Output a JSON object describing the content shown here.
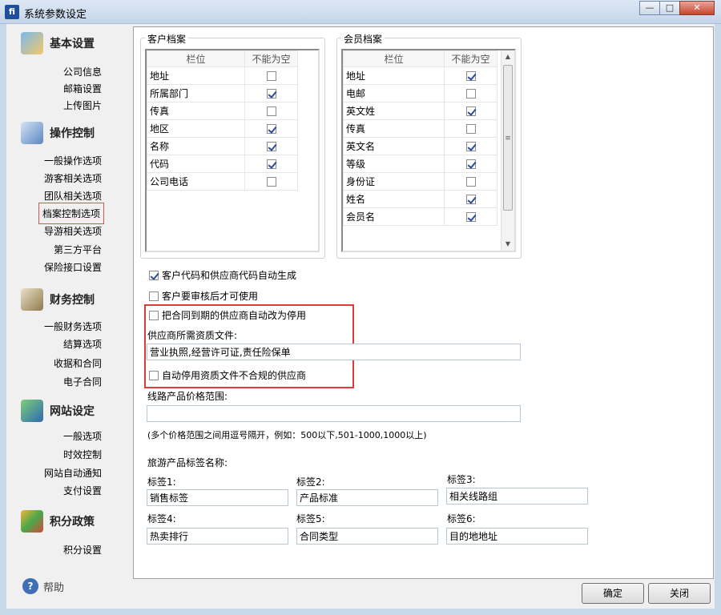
{
  "window": {
    "title": "系统参数设定",
    "app_icon_glyph": "fi"
  },
  "sidebar": {
    "sections": [
      {
        "label": "基本设置",
        "icon": "box-icon",
        "items": [
          "公司信息",
          "邮箱设置",
          "上传图片"
        ]
      },
      {
        "label": "操作控制",
        "icon": "edit-icon",
        "items": [
          "一般操作选项",
          "游客相关选项",
          "团队相关选项",
          "档案控制选项",
          "导游相关选项",
          "第三方平台",
          "保险接口设置"
        ]
      },
      {
        "label": "财务控制",
        "icon": "scale-icon",
        "items": [
          "一般财务选项",
          "结算选项",
          "收据和合同",
          "电子合同"
        ]
      },
      {
        "label": "网站设定",
        "icon": "network-icon",
        "items": [
          "一般选项",
          "时效控制",
          "网站自动通知",
          "支付设置"
        ]
      },
      {
        "label": "积分政策",
        "icon": "cubes-icon",
        "items": [
          "积分设置"
        ]
      }
    ],
    "active_item": "档案控制选项",
    "help_label": "帮助"
  },
  "customer_group": {
    "title": "客户档案",
    "col_field": "栏位",
    "col_required": "不能为空",
    "rows": [
      {
        "name": "地址",
        "checked": false
      },
      {
        "name": "所属部门",
        "checked": true
      },
      {
        "name": "传真",
        "checked": false
      },
      {
        "name": "地区",
        "checked": true
      },
      {
        "name": "名称",
        "checked": true
      },
      {
        "name": "代码",
        "checked": true
      },
      {
        "name": "公司电话",
        "checked": false
      }
    ]
  },
  "member_group": {
    "title": "会员档案",
    "col_field": "栏位",
    "col_required": "不能为空",
    "rows": [
      {
        "name": "地址",
        "checked": true
      },
      {
        "name": "电邮",
        "checked": false
      },
      {
        "name": "英文姓",
        "checked": true
      },
      {
        "name": "传真",
        "checked": false
      },
      {
        "name": "英文名",
        "checked": true
      },
      {
        "name": "等级",
        "checked": true
      },
      {
        "name": "身份证",
        "checked": false
      },
      {
        "name": "姓名",
        "checked": true
      },
      {
        "name": "会员名",
        "checked": true
      }
    ]
  },
  "options": {
    "auto_code": {
      "label": "客户代码和供应商代码自动生成",
      "checked": true
    },
    "require_review": {
      "label": "客户要审核后才可使用",
      "checked": false
    },
    "auto_disable_expired": {
      "label": "把合同到期的供应商自动改为停用",
      "checked": false
    },
    "qualification_label": "供应商所需资质文件:",
    "qualification_value": "营业执照,经营许可证,责任险保单",
    "auto_disable_noncompliant": {
      "label": "自动停用资质文件不合规的供应商",
      "checked": false
    },
    "price_range_label": "线路产品价格范围:",
    "price_range_value": "",
    "price_range_hint": "(多个价格范围之间用逗号隔开，例如：500以下,501-1000,1000以上)",
    "tag_names_label": "旅游产品标签名称:"
  },
  "tags": [
    {
      "label": "标签1:",
      "value": "销售标签"
    },
    {
      "label": "标签2:",
      "value": "产品标准"
    },
    {
      "label": "标签3:",
      "value": "相关线路组"
    },
    {
      "label": "标签4:",
      "value": "热卖排行"
    },
    {
      "label": "标签5:",
      "value": "合同类型"
    },
    {
      "label": "标签6:",
      "value": "目的地地址"
    }
  ],
  "buttons": {
    "ok": "确定",
    "close": "关闭"
  },
  "colors": {
    "highlight_border": "#e03a3a",
    "check_color": "#2a4b9b"
  }
}
